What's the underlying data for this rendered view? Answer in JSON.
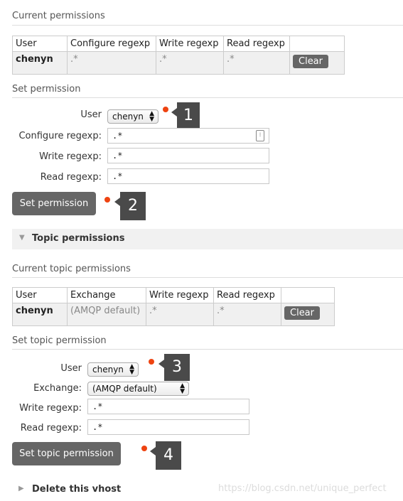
{
  "permissions": {
    "current_title": "Current permissions",
    "headers": [
      "User",
      "Configure regexp",
      "Write regexp",
      "Read regexp"
    ],
    "rows": [
      {
        "user": "chenyn",
        "configure": ".*",
        "write": ".*",
        "read": ".*",
        "action": "Clear"
      }
    ],
    "set_title": "Set permission",
    "user_label": "User",
    "user_value": "chenyn",
    "configure_label": "Configure regexp:",
    "configure_value": ".*",
    "write_label": "Write regexp:",
    "write_value": ".*",
    "read_label": "Read regexp:",
    "read_value": ".*",
    "submit_label": "Set permission"
  },
  "topic": {
    "section_label": "Topic permissions",
    "current_title": "Current topic permissions",
    "headers": [
      "User",
      "Exchange",
      "Write regexp",
      "Read regexp"
    ],
    "rows": [
      {
        "user": "chenyn",
        "exchange": "(AMQP default)",
        "write": ".*",
        "read": ".*",
        "action": "Clear"
      }
    ],
    "set_title": "Set topic permission",
    "user_label": "User",
    "user_value": "chenyn",
    "exchange_label": "Exchange:",
    "exchange_value": "(AMQP default)",
    "write_label": "Write regexp:",
    "write_value": ".*",
    "read_label": "Read regexp:",
    "read_value": ".*",
    "submit_label": "Set topic permission"
  },
  "delete_label": "Delete this vhost",
  "callouts": [
    "1",
    "2",
    "3",
    "4"
  ],
  "watermark": "https://blog.csdn.net/unique_perfect",
  "colors": {
    "dot": "#ee4311",
    "callout_bg": "#4a4a4a",
    "button_bg": "#666666"
  }
}
